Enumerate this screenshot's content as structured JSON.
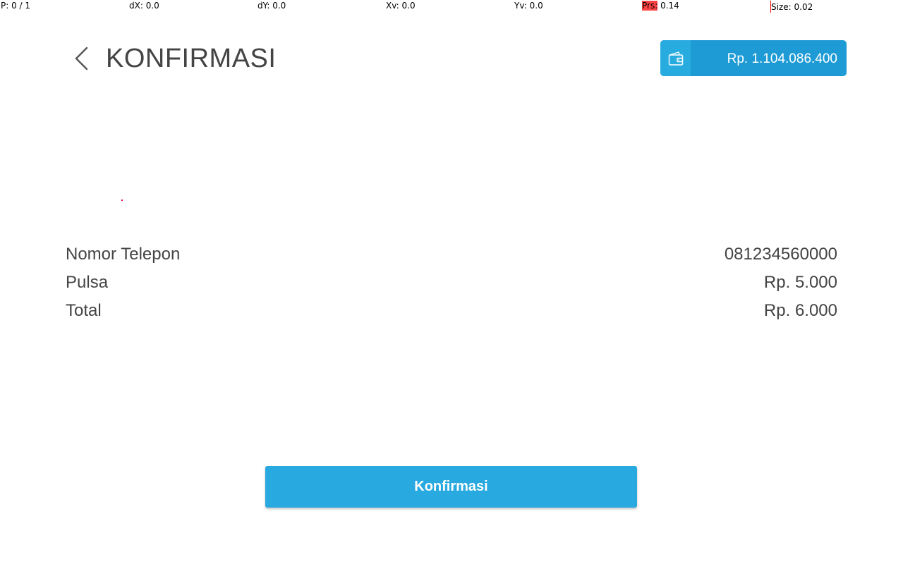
{
  "debug": {
    "pointer": "P: 0 / 1",
    "dx": "dX: 0.0",
    "dy": "dY: 0.0",
    "xv": "Xv: 0.0",
    "yv": "Yv: 0.0",
    "prs_label": "Prs:",
    "prs_value": " 0.14",
    "size": "Size: 0.02"
  },
  "header": {
    "back_icon": "chevron-left-icon",
    "title": "KONFIRMASI",
    "balance_icon": "wallet-icon",
    "balance": "Rp. 1.104.086.400"
  },
  "details": [
    {
      "label": "Nomor Telepon",
      "value": "081234560000"
    },
    {
      "label": "Pulsa",
      "value": "Rp. 5.000"
    },
    {
      "label": "Total",
      "value": "Rp. 6.000"
    }
  ],
  "actions": {
    "confirm_label": "Konfirmasi"
  },
  "colors": {
    "accent": "#28a9e0",
    "accent_dark": "#1e9bd4",
    "text": "#444444",
    "touch_dot": "#e0004a"
  }
}
